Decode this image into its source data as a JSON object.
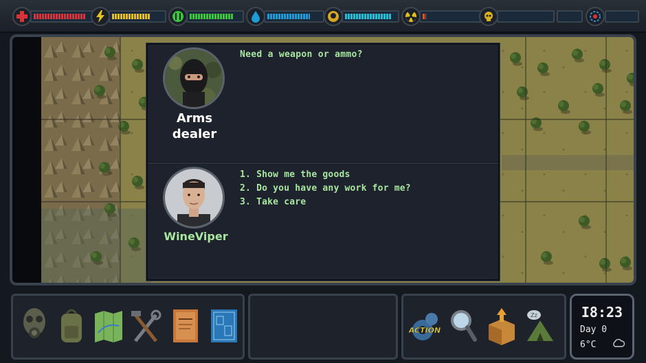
{
  "status": {
    "health": {
      "icon": "health-cross-icon",
      "color": "#d8323a",
      "level": 0.88
    },
    "energy": {
      "icon": "lightning-icon",
      "color": "#e8c020",
      "level": 0.75
    },
    "hunger": {
      "icon": "food-icon",
      "color": "#3ac83a",
      "level": 0.85
    },
    "thirst": {
      "icon": "water-drop-icon",
      "color": "#1e9cd8",
      "level": 0.8
    },
    "mental": {
      "icon": "head-icon",
      "color": "#20c0d8",
      "level": 0.9
    },
    "radiation": {
      "icon": "radiation-icon",
      "color": "#e05020",
      "level": 0.05
    },
    "toxicity": {
      "icon": "skull-icon",
      "color": "#8fb04a",
      "level": 0.0
    },
    "temperature": {
      "icon": "thermometer-icon",
      "color": "#3a8ad0",
      "level": 0.0
    }
  },
  "dialog": {
    "npc_name_line1": "Arms",
    "npc_name_line2": "dealer",
    "npc_text": "Need a weapon or ammo?",
    "player_name": "WineViper",
    "options": [
      "1. Show me the goods",
      "2. Do you have any work for me?",
      "3. Take care"
    ]
  },
  "toolbar": {
    "left": [
      "gas-mask-icon",
      "backpack-icon",
      "map-icon",
      "tools-icon",
      "journal-icon",
      "blueprint-icon"
    ],
    "right": [
      "action-gear-icon",
      "magnifier-icon",
      "crafting-box-icon",
      "camp-tent-icon"
    ],
    "action_label": "ACTION"
  },
  "clock": {
    "time": "I8:23",
    "day": "Day 0",
    "temperature": "6°C",
    "weather_icon": "cloud-icon"
  }
}
